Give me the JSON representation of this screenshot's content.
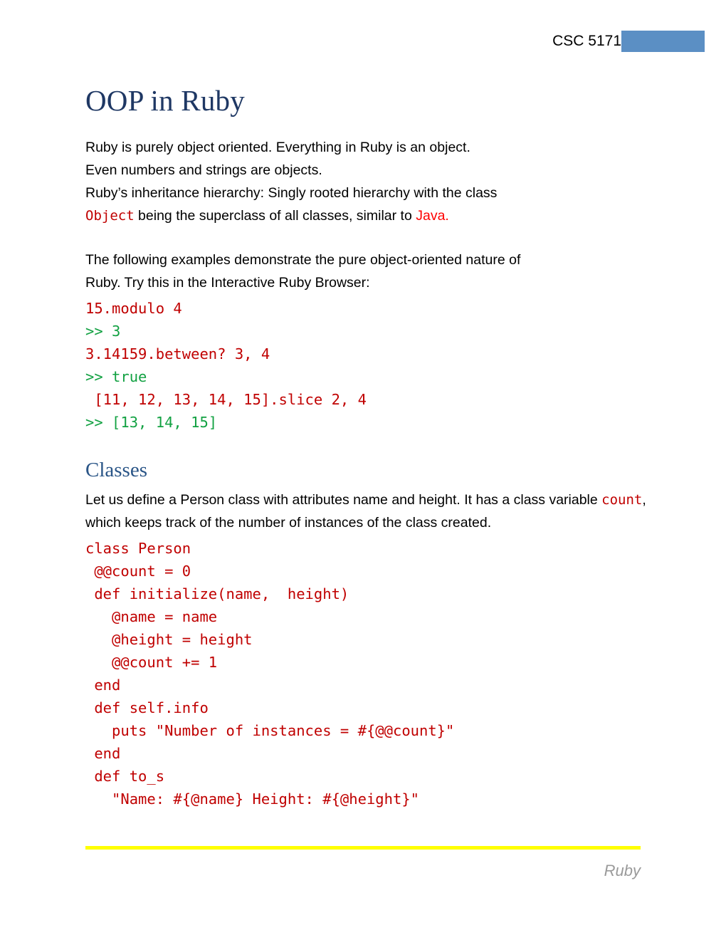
{
  "header": {
    "course_label": "CSC 5171",
    "selection_color": "#5B8FC4"
  },
  "document": {
    "title": "OOP in Ruby"
  },
  "intro": {
    "line1": "Ruby is purely object oriented.  Everything in Ruby is an object.",
    "line2": "Even numbers and strings are objects.",
    "line3": "Ruby’s inheritance hierarchy: Singly rooted hierarchy with the class",
    "line4_code": "Object",
    "line4_mid": " being the superclass of all classes, similar to ",
    "line4_java": "Java."
  },
  "examples_intro": {
    "line1": "The following examples demonstrate the pure object-oriented nature of",
    "line2": "Ruby. Try this in the Interactive Ruby Browser:"
  },
  "irb_block": {
    "lines": [
      {
        "text": "15.modulo 4",
        "kind": "input"
      },
      {
        "text": ">> 3",
        "kind": "output"
      },
      {
        "text": "3.14159.between? 3, 4",
        "kind": "input"
      },
      {
        "text": ">> true",
        "kind": "output"
      },
      {
        "text": " [11, 12, 13, 14, 15].slice 2, 4",
        "kind": "input"
      },
      {
        "text": ">> [13, 14, 15]",
        "kind": "output"
      }
    ]
  },
  "classes_section": {
    "heading": "Classes",
    "para_part1": "Let us define a Person class with attributes name and height.  It has a class variable ",
    "para_code": "count",
    "para_part2": ", which keeps track of the number of instances of the class created."
  },
  "class_code_block": {
    "lines": [
      {
        "text": "class Person",
        "kind": "input"
      },
      {
        "text": " @@count = 0",
        "kind": "input"
      },
      {
        "text": " def initialize(name,  height)",
        "kind": "input"
      },
      {
        "text": "   @name = name",
        "kind": "input"
      },
      {
        "text": "   @height = height",
        "kind": "input"
      },
      {
        "text": "   @@count += 1",
        "kind": "input"
      },
      {
        "text": " end",
        "kind": "input"
      },
      {
        "text": " def self.info",
        "kind": "input"
      },
      {
        "text": "   puts \"Number of instances = #{@@count}\"",
        "kind": "input"
      },
      {
        "text": " end",
        "kind": "input"
      },
      {
        "text": " def to_s",
        "kind": "input"
      },
      {
        "text": "   \"Name: #{@name} Height: #{@height}\"",
        "kind": "input"
      }
    ]
  },
  "footer": {
    "label": "Ruby",
    "rule_color": "#FFFF00"
  },
  "colors": {
    "title_navy": "#1F3864",
    "heading_blue": "#2A5587",
    "code_red": "#C00000",
    "code_green": "#12A142",
    "java_red": "#FF0000",
    "footer_gray": "#9A9A9A"
  }
}
